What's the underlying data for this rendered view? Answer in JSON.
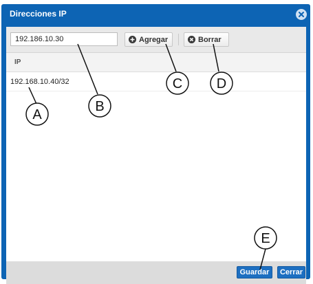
{
  "dialog": {
    "title": "Direcciones IP",
    "close_icon": "close-circle-icon"
  },
  "toolbar": {
    "ip_input_value": "192.186.10.30",
    "add_label": "Agregar",
    "add_icon": "plus-circle-icon",
    "delete_label": "Borrar",
    "delete_icon": "x-circle-icon"
  },
  "grid": {
    "columns": [
      "IP"
    ],
    "rows": [
      {
        "ip": "192.168.10.40/32"
      }
    ]
  },
  "footer": {
    "save_label": "Guardar",
    "close_label": "Cerrar"
  },
  "callouts": [
    "A",
    "B",
    "C",
    "D",
    "E"
  ],
  "colors": {
    "frame": "#0d64b4",
    "primary_button": "#1d6fc1",
    "toolbar": "#e9e9e9",
    "footer": "#dcdcdc"
  }
}
